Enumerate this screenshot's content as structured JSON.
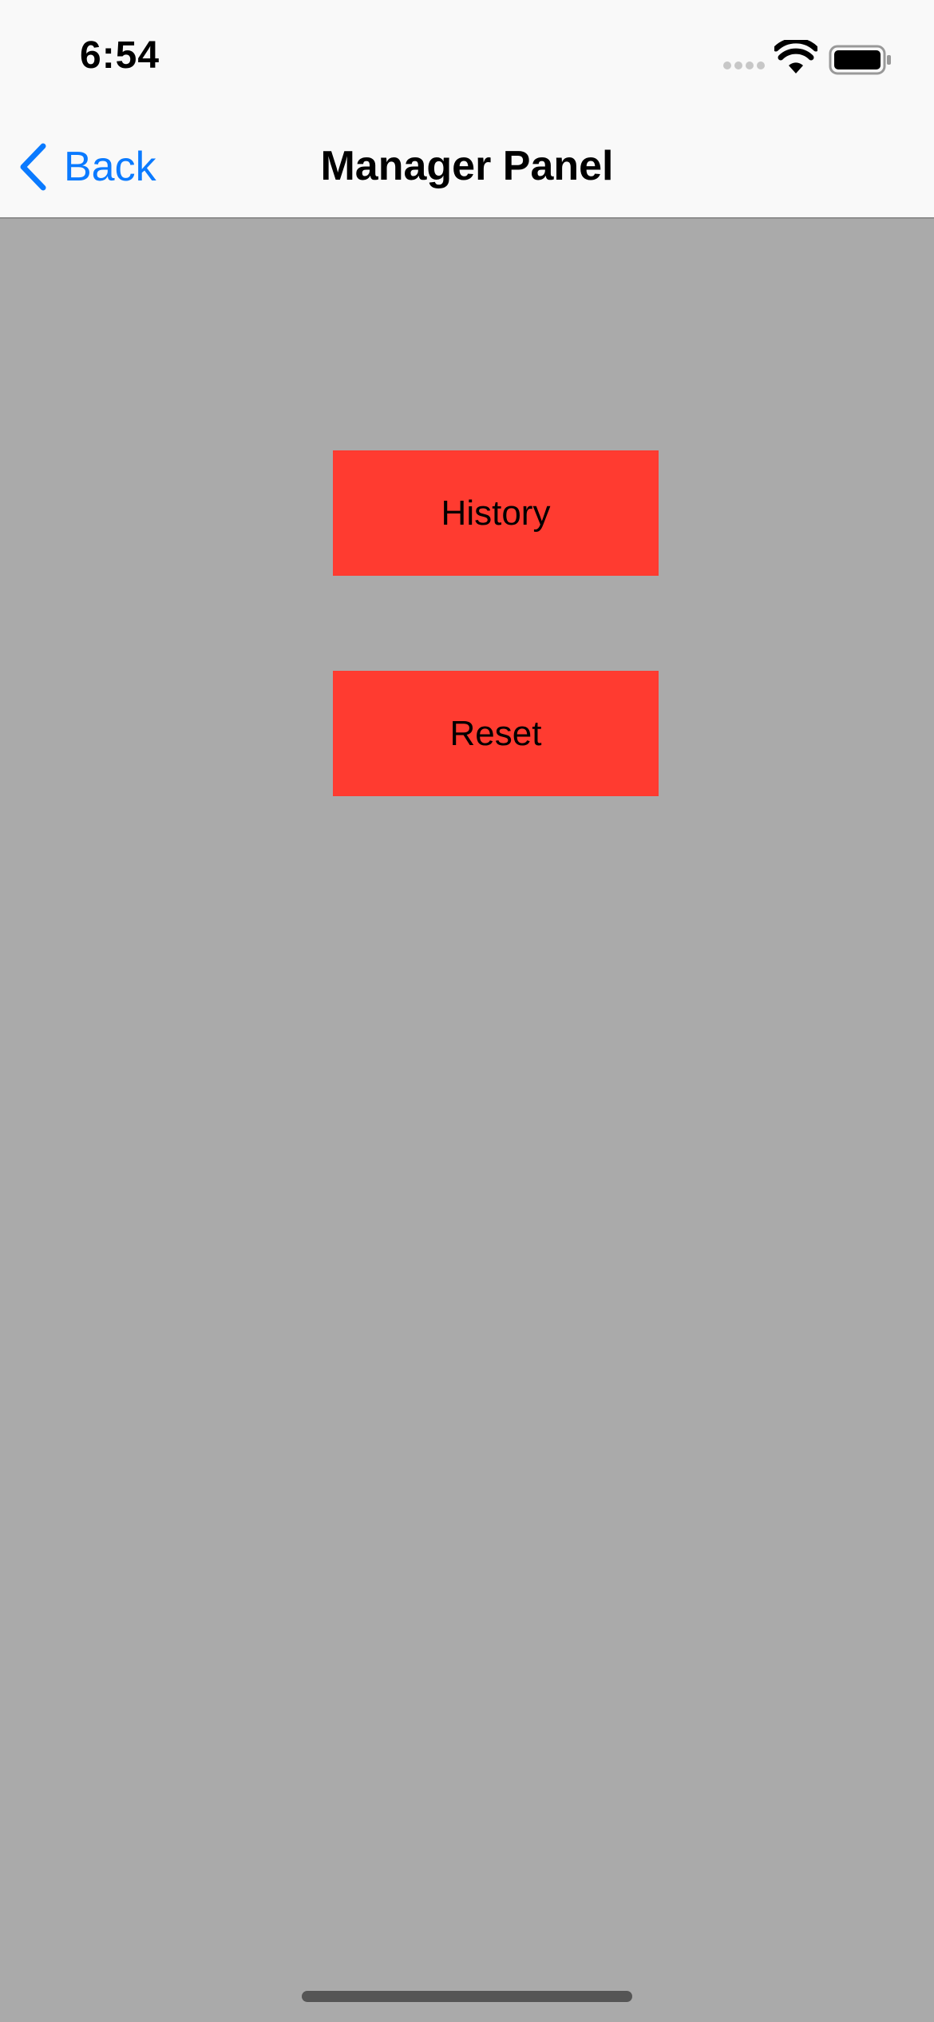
{
  "status_bar": {
    "time": "6:54",
    "signal_icon": "cellular-signal-icon",
    "wifi_icon": "wifi-icon",
    "battery_icon": "battery-icon"
  },
  "nav": {
    "back_label": "Back",
    "back_icon": "chevron-left-icon",
    "title": "Manager Panel"
  },
  "actions": {
    "history_label": "History",
    "reset_label": "Reset"
  },
  "colors": {
    "background": "#aaaaaa",
    "button": "#ff3b30",
    "accent": "#0a7aff",
    "bar": "#f9f9f9"
  }
}
